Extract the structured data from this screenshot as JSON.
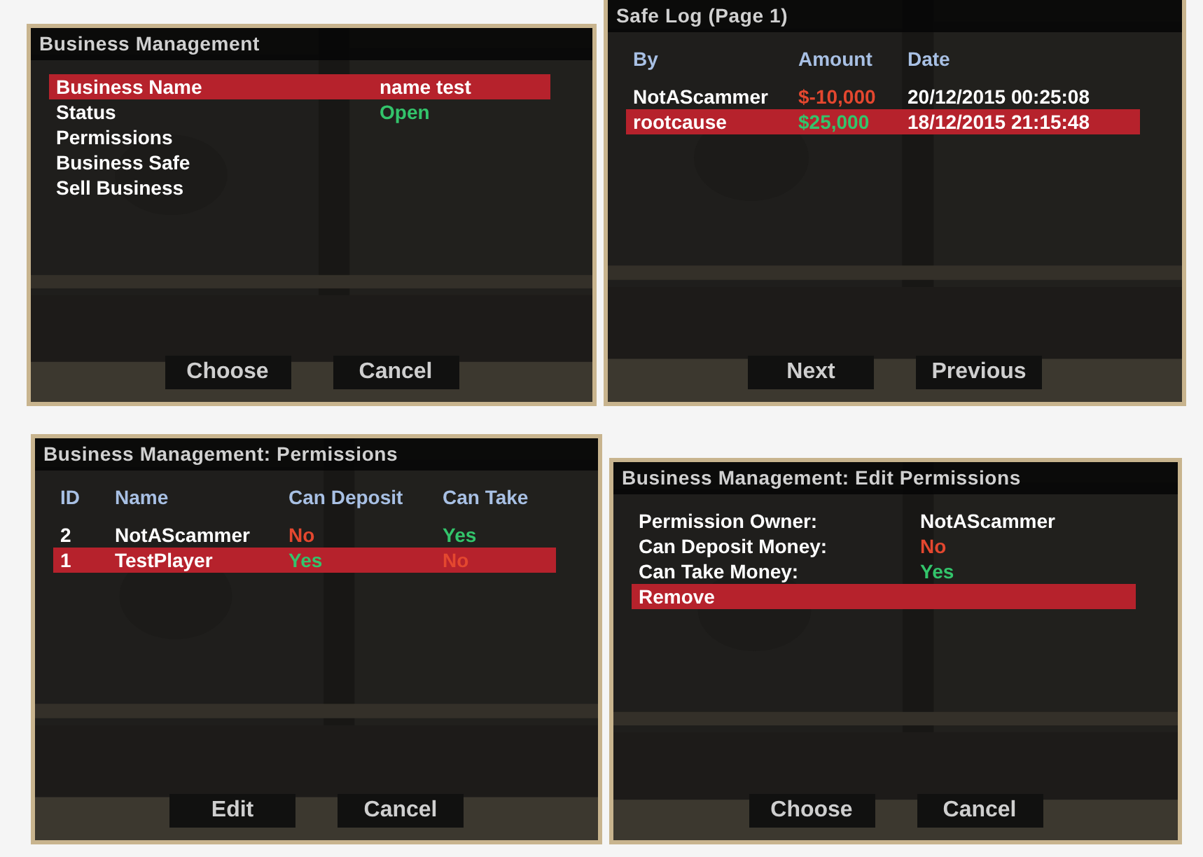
{
  "dialogs": [
    {
      "title": "Business Management",
      "rows": [
        {
          "selected": true,
          "cells": [
            {
              "text": "Business Name"
            },
            {
              "text": "name test"
            }
          ]
        },
        {
          "selected": false,
          "cells": [
            {
              "text": "Status"
            },
            {
              "text": "Open",
              "color": "#33c46b"
            }
          ]
        },
        {
          "selected": false,
          "cells": [
            {
              "text": "Permissions"
            }
          ]
        },
        {
          "selected": false,
          "cells": [
            {
              "text": "Business Safe"
            }
          ]
        },
        {
          "selected": false,
          "cells": [
            {
              "text": "Sell Business"
            }
          ]
        }
      ],
      "buttons": [
        "Choose",
        "Cancel"
      ]
    },
    {
      "title": "Safe Log (Page 1)",
      "columns": [
        "By",
        "Amount",
        "Date"
      ],
      "rows": [
        {
          "selected": false,
          "cells": [
            {
              "text": "NotAScammer"
            },
            {
              "text": "$-10,000",
              "color": "#e4472f"
            },
            {
              "text": "20/12/2015 00:25:08"
            }
          ]
        },
        {
          "selected": true,
          "cells": [
            {
              "text": "rootcause"
            },
            {
              "text": "$25,000",
              "color": "#33c46b"
            },
            {
              "text": "18/12/2015 21:15:48"
            }
          ]
        }
      ],
      "buttons": [
        "Next",
        "Previous"
      ]
    },
    {
      "title": "Business Management: Permissions",
      "columns": [
        "ID",
        "Name",
        "Can Deposit",
        "Can Take"
      ],
      "rows": [
        {
          "selected": false,
          "cells": [
            {
              "text": "2"
            },
            {
              "text": "NotAScammer"
            },
            {
              "text": "No",
              "color": "#e4472f"
            },
            {
              "text": "Yes",
              "color": "#33c46b"
            }
          ]
        },
        {
          "selected": true,
          "cells": [
            {
              "text": "1"
            },
            {
              "text": "TestPlayer"
            },
            {
              "text": "Yes",
              "color": "#33c46b"
            },
            {
              "text": "No",
              "color": "#e4472f"
            }
          ]
        }
      ],
      "buttons": [
        "Edit",
        "Cancel"
      ]
    },
    {
      "title": "Business Management: Edit Permissions",
      "rows": [
        {
          "selected": false,
          "cells": [
            {
              "text": "Permission Owner:"
            },
            {
              "text": "NotAScammer"
            }
          ]
        },
        {
          "selected": false,
          "cells": [
            {
              "text": "Can Deposit Money:"
            },
            {
              "text": "No",
              "color": "#e4472f"
            }
          ]
        },
        {
          "selected": false,
          "cells": [
            {
              "text": "Can Take Money:"
            },
            {
              "text": "Yes",
              "color": "#33c46b"
            }
          ]
        },
        {
          "selected": true,
          "cells": [
            {
              "text": "Remove"
            }
          ]
        }
      ],
      "buttons": [
        "Choose",
        "Cancel"
      ]
    }
  ]
}
